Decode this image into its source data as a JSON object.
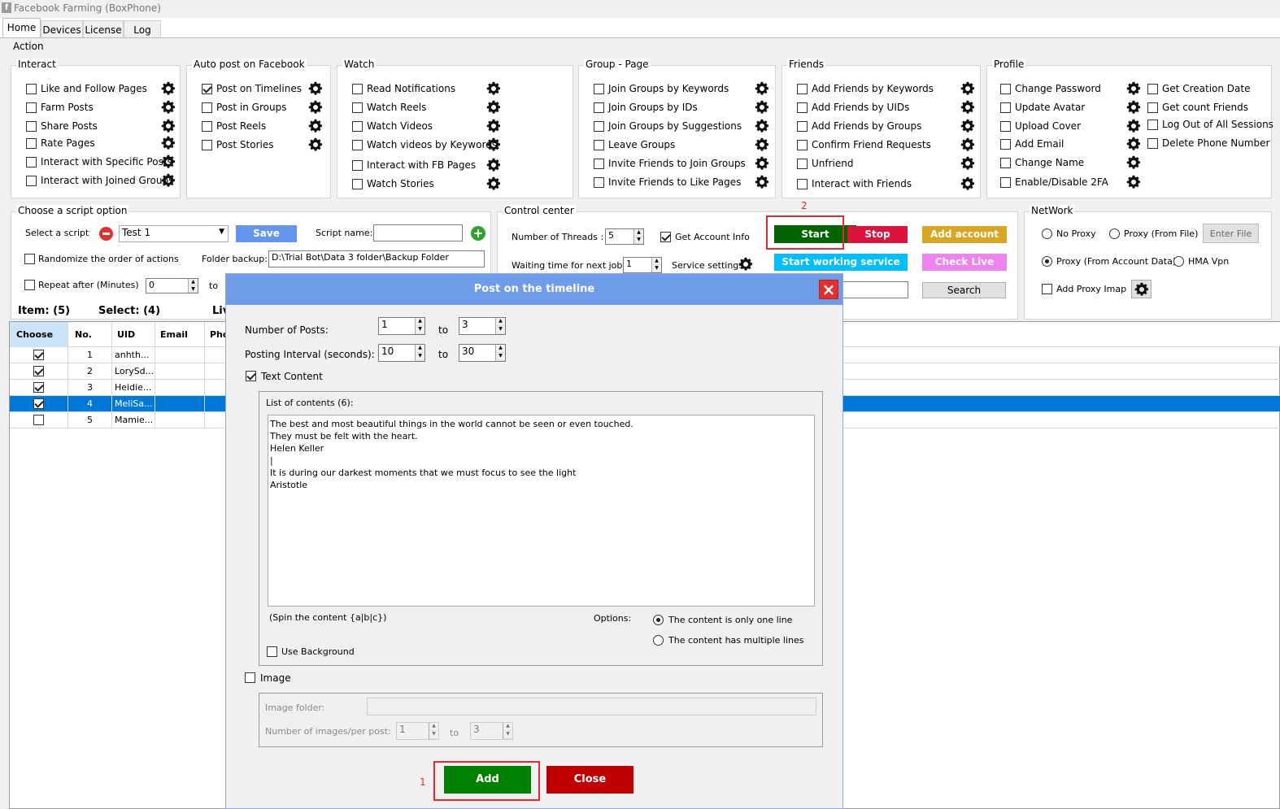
{
  "app": {
    "title": "Facebook Farming (BoxPhone)"
  },
  "tabs": [
    "Home",
    "Devices",
    "License",
    "Log"
  ],
  "action_label": "Action",
  "groups": {
    "interact": {
      "title": "Interact",
      "items": [
        {
          "label": "Like and Follow Pages",
          "checked": false
        },
        {
          "label": "Farm Posts",
          "checked": false
        },
        {
          "label": "Share Posts",
          "checked": false
        },
        {
          "label": "Rate Pages",
          "checked": false
        },
        {
          "label": "Interact with Specific Posts",
          "checked": false
        },
        {
          "label": "Interact with Joined Groups",
          "checked": false
        }
      ]
    },
    "autopost": {
      "title": "Auto post on Facebook",
      "items": [
        {
          "label": "Post on Timelines",
          "checked": true
        },
        {
          "label": "Post in Groups",
          "checked": false
        },
        {
          "label": "Post Reels",
          "checked": false
        },
        {
          "label": "Post Stories",
          "checked": false
        }
      ]
    },
    "watch": {
      "title": "Watch",
      "items": [
        {
          "label": "Read Notifications",
          "checked": false
        },
        {
          "label": "Watch Reels",
          "checked": false
        },
        {
          "label": "Watch Videos",
          "checked": false
        },
        {
          "label": "Watch videos by Keywords",
          "checked": false
        },
        {
          "label": "Interact with FB Pages",
          "checked": false
        },
        {
          "label": "Watch Stories",
          "checked": false
        }
      ]
    },
    "group_page": {
      "title": "Group - Page",
      "items": [
        {
          "label": "Join Groups by Keywords",
          "checked": false
        },
        {
          "label": "Join Groups by IDs",
          "checked": false
        },
        {
          "label": "Join Groups by Suggestions",
          "checked": false
        },
        {
          "label": "Leave Groups",
          "checked": false
        },
        {
          "label": "Invite Friends to Join Groups",
          "checked": false
        },
        {
          "label": "Invite Friends to Like Pages",
          "checked": false
        }
      ]
    },
    "friends": {
      "title": "Friends",
      "items": [
        {
          "label": "Add Friends by Keywords",
          "checked": false
        },
        {
          "label": "Add Friends by UIDs",
          "checked": false
        },
        {
          "label": "Add Friends by  Groups",
          "checked": false
        },
        {
          "label": "Confirm Friend Requests",
          "checked": false
        },
        {
          "label": "Unfriend",
          "checked": false
        },
        {
          "label": "Interact with Friends",
          "checked": false
        }
      ]
    },
    "profile": {
      "title": "Profile",
      "items_left": [
        {
          "label": "Change Password",
          "checked": false
        },
        {
          "label": "Update Avatar",
          "checked": false
        },
        {
          "label": "Upload Cover",
          "checked": false
        },
        {
          "label": "Add Email",
          "checked": false
        },
        {
          "label": "Change Name",
          "checked": false
        },
        {
          "label": "Enable/Disable 2FA",
          "checked": false
        }
      ],
      "items_right": [
        {
          "label": "Get Creation Date",
          "checked": false
        },
        {
          "label": "Get count Friends",
          "checked": false
        },
        {
          "label": "Log Out of All Sessions",
          "checked": false
        },
        {
          "label": "Delete Phone Number",
          "checked": false
        }
      ]
    }
  },
  "script": {
    "title": "Choose a script option",
    "select_label": "Select a script",
    "selected": "Test 1",
    "save": "Save",
    "name_label": "Script name:",
    "name_value": "",
    "randomize_label": "Randomize the order of actions",
    "folder_label": "Folder backup:",
    "folder_value": "D:\\Trial Bot\\Data 3 folder\\Backup Folder",
    "repeat_label": "Repeat after (Minutes)",
    "repeat_value": "0",
    "to": "to"
  },
  "control": {
    "title": "Control center",
    "threads_label": "Number of Threads :",
    "threads_value": "5",
    "get_account_info": "Get Account Info",
    "waiting_label": "Waiting time for next job :",
    "waiting_value": "1",
    "service_settings": "Service settings",
    "start": "Start",
    "stop": "Stop",
    "add_account": "Add account",
    "start_working_service": "Start working service",
    "check_live": "Check Live",
    "search": "Search"
  },
  "network": {
    "title": "NetWork",
    "no_proxy": "No Proxy",
    "proxy_file": "Proxy (From File)",
    "enter_file": "Enter File",
    "proxy_account": "Proxy (From Account Data)",
    "hma": "HMA Vpn",
    "add_proxy": "Add Proxy Imap"
  },
  "summary": {
    "items": "Item: (5)",
    "select": "Select: (4)",
    "live_partial": "Liv"
  },
  "grid": {
    "columns": [
      "Choose",
      "No.",
      "UID",
      "Email",
      "Pho"
    ],
    "rows": [
      {
        "checked": true,
        "no": "1",
        "uid": "anhth..."
      },
      {
        "checked": true,
        "no": "2",
        "uid": "LorySd..."
      },
      {
        "checked": true,
        "no": "3",
        "uid": "Heidie..."
      },
      {
        "checked": true,
        "no": "4",
        "uid": "MeliSa...",
        "selected": true
      },
      {
        "checked": false,
        "no": "5",
        "uid": "Mamie..."
      }
    ]
  },
  "modal": {
    "title": "Post on the timeline",
    "num_posts_label": "Number of Posts:",
    "num_posts_from": "1",
    "num_posts_to": "3",
    "interval_label": "Posting Interval (seconds):",
    "interval_from": "10",
    "interval_to": "30",
    "to": "to",
    "text_content": "Text Content",
    "list_label": "List of contents (6):",
    "content_lines": [
      "The best and most beautiful things in the world cannot be seen or even touched.",
      "They must be felt with the heart.",
      "Helen Keller",
      "|",
      "It is during our darkest moments that we must focus to see the light",
      "Aristotle"
    ],
    "spin_hint": "(Spin the content {a|b|c})",
    "options_label": "Options:",
    "opt_one_line": "The content is only one line",
    "opt_multi": "The content has multiple lines",
    "use_background": "Use Background",
    "image": "Image",
    "image_folder_label": "Image folder:",
    "images_per_post_label": "Number of images/per post:",
    "images_from": "1",
    "images_to": "3",
    "add": "Add",
    "close": "Close"
  },
  "markers": {
    "one": "1",
    "two": "2"
  },
  "colors": {
    "start": "#006400",
    "stop": "#dc143c",
    "add_account": "#daa520",
    "service": "#00bfff",
    "check_live": "#ee82ee",
    "save": "#6495ed",
    "selected_row": "#0078d7",
    "add": "#008000",
    "close": "#c00000"
  }
}
